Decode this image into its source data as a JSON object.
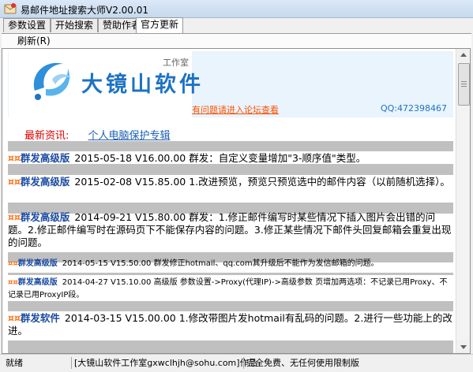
{
  "window": {
    "title": "易邮件地址搜索大师V2.00.01"
  },
  "tabs": [
    {
      "label": "参数设置"
    },
    {
      "label": "开始搜索"
    },
    {
      "label": "赞助作者"
    },
    {
      "label": "官方更新"
    }
  ],
  "toolbar": {
    "refresh_label": "刷新(R)"
  },
  "banner": {
    "brand_name": "大镜山软件",
    "brand_sub": "工作室",
    "forum_link": "有问题请进入论坛查看",
    "qq": "QQ:472398467"
  },
  "news": {
    "label": "最新资讯:",
    "link": "个人电脑保护专辑"
  },
  "entries": [
    {
      "lead": "¤¤",
      "edition": "群发高级版",
      "text": "2015-05-18 V16.00.00 群发：自定义变量增加\"3-顺序值\"类型。"
    },
    {
      "lead": "¤¤",
      "edition": "群发高级版",
      "text": "2015-02-08 V15.85.00 1.改进预览，预览只预览选中的邮件内容（以前随机选择）。"
    },
    {
      "lead": "¤¤",
      "edition": "群发高级版",
      "text": "2014-09-21 V15.80.00 群发：1.修正邮件编写时某些情况下插入图片会出错的问题。2.修正邮件编写时在源码页下不能保存内容的问题。3.修正某些情况下邮件头回复邮箱会重复出现的问题。"
    },
    {
      "lead": "¤¤",
      "edition": "群发高级版",
      "text": "2014-05-15 V15.50.00 群发修正hotmail、qq.com其升级后不能作为发信邮箱的问题。"
    },
    {
      "lead": "¤¤",
      "edition": "群发高级版",
      "text": "2014-04-27 V15.10.00 高级版 参数设置->Proxy(代理IP)->高级参数 页增加两选项：不记录已用Proxy、不记录已用ProxyIP段。"
    },
    {
      "lead": "¤¤",
      "edition": "群发软件",
      "text": "2014-03-15 V15.00.00 1.修改带图片发hotmail有乱码的问题。2.进行一些功能上的改进。"
    }
  ],
  "status": {
    "state": "就绪",
    "author": "[大镜山软件工作室gxwclhjh@sohu.com]作品",
    "license": "完全免费、无任何使用限制版"
  },
  "colors": {
    "brand_blue": "#1e73c3",
    "news_red": "#e00000",
    "link_orange": "#ff5000",
    "edition_blue": "#1c4ba0",
    "lead_orange": "#ff6600"
  },
  "icons": [
    "app-icon",
    "scroll-up-icon",
    "scroll-down-icon",
    "logo-swirl-icon"
  ]
}
